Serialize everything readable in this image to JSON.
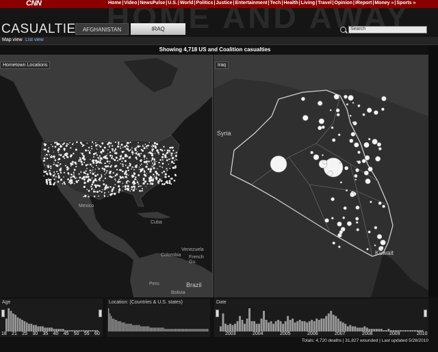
{
  "brand": {
    "logo": "CNN"
  },
  "nav": {
    "items": [
      "Home",
      "Video",
      "NewsPulse",
      "U.S.",
      "World",
      "Politics",
      "Justice",
      "Entertainment",
      "Tech",
      "Health",
      "Living",
      "Travel",
      "Opinion",
      "iReport",
      "Money »",
      "Sports »"
    ],
    "separator": " | "
  },
  "header": {
    "background_title": "HOME AND AWAY",
    "title": "CASUALTIES:",
    "tabs": [
      {
        "label": "AFGHANISTAN",
        "active": false
      },
      {
        "label": "IRAQ",
        "active": true
      }
    ],
    "search": {
      "value": "Search"
    }
  },
  "view": {
    "map_label": "Map view",
    "list_label": "List view"
  },
  "summary": {
    "text": "Showing 4,718 US and Coalition casualties"
  },
  "map_us": {
    "label": "Hometown Locations",
    "places": [
      "Mexico",
      "Cuba",
      "Colombia",
      "Venezuela",
      "Peru",
      "Brazil",
      "Bolivia",
      "French Gu."
    ]
  },
  "map_iraq": {
    "label": "Iraq",
    "places": [
      "Syria",
      "Kuwait"
    ]
  },
  "histograms": {
    "age": {
      "title": "Age",
      "ticks": [
        "18",
        "21",
        "25",
        "30",
        "35",
        "40",
        "45",
        "50",
        "55",
        "60"
      ],
      "values": [
        10,
        18,
        16,
        14,
        13,
        11,
        10,
        9,
        8,
        7,
        6,
        6,
        5,
        5,
        4,
        4,
        4,
        3,
        3,
        3,
        3,
        2,
        2,
        2,
        2,
        2,
        1,
        1,
        1,
        1,
        1,
        1,
        1,
        1,
        1,
        1,
        1,
        1,
        1,
        1,
        1
      ]
    },
    "location": {
      "title": "Location: (Countries & U.S. states)",
      "values": [
        18,
        14,
        12,
        10,
        10,
        9,
        9,
        8,
        8,
        8,
        7,
        7,
        7,
        6,
        6,
        6,
        6,
        6,
        5,
        5,
        5,
        5,
        5,
        5,
        4,
        4,
        4,
        4,
        4,
        4,
        4,
        3,
        3,
        3,
        3,
        3,
        3,
        3,
        3,
        3,
        3,
        3,
        2,
        2,
        2,
        2,
        2,
        2,
        2,
        2,
        2,
        2,
        2,
        2,
        2,
        2,
        2,
        2,
        2,
        2,
        2,
        2,
        2,
        2,
        2,
        2,
        2,
        2,
        2,
        2,
        2,
        2,
        2,
        2,
        2
      ]
    },
    "date": {
      "title": "Date",
      "ticks": [
        "2003",
        "2004",
        "2005",
        "2006",
        "2007",
        "2008",
        "2009",
        "2010"
      ],
      "values": [
        4,
        14,
        6,
        5,
        6,
        5,
        6,
        8,
        12,
        9,
        6,
        10,
        18,
        8,
        8,
        6,
        6,
        10,
        16,
        9,
        7,
        8,
        6,
        8,
        9,
        8,
        6,
        8,
        12,
        9,
        10,
        7,
        8,
        9,
        8,
        8,
        7,
        8,
        9,
        8,
        10,
        9,
        10,
        10,
        12,
        14,
        16,
        13,
        12,
        10,
        8,
        7,
        6,
        4,
        5,
        4,
        4,
        3,
        3,
        3,
        4,
        3,
        2,
        2,
        2,
        2,
        2,
        2,
        1,
        1,
        2,
        1,
        1,
        1,
        1,
        1,
        1,
        1,
        1,
        1,
        1,
        1,
        1,
        1,
        1
      ]
    }
  },
  "footer": {
    "totals": "Totals: 4,720 deaths | 31,827 wounded | Last updated 5/28/2010"
  }
}
